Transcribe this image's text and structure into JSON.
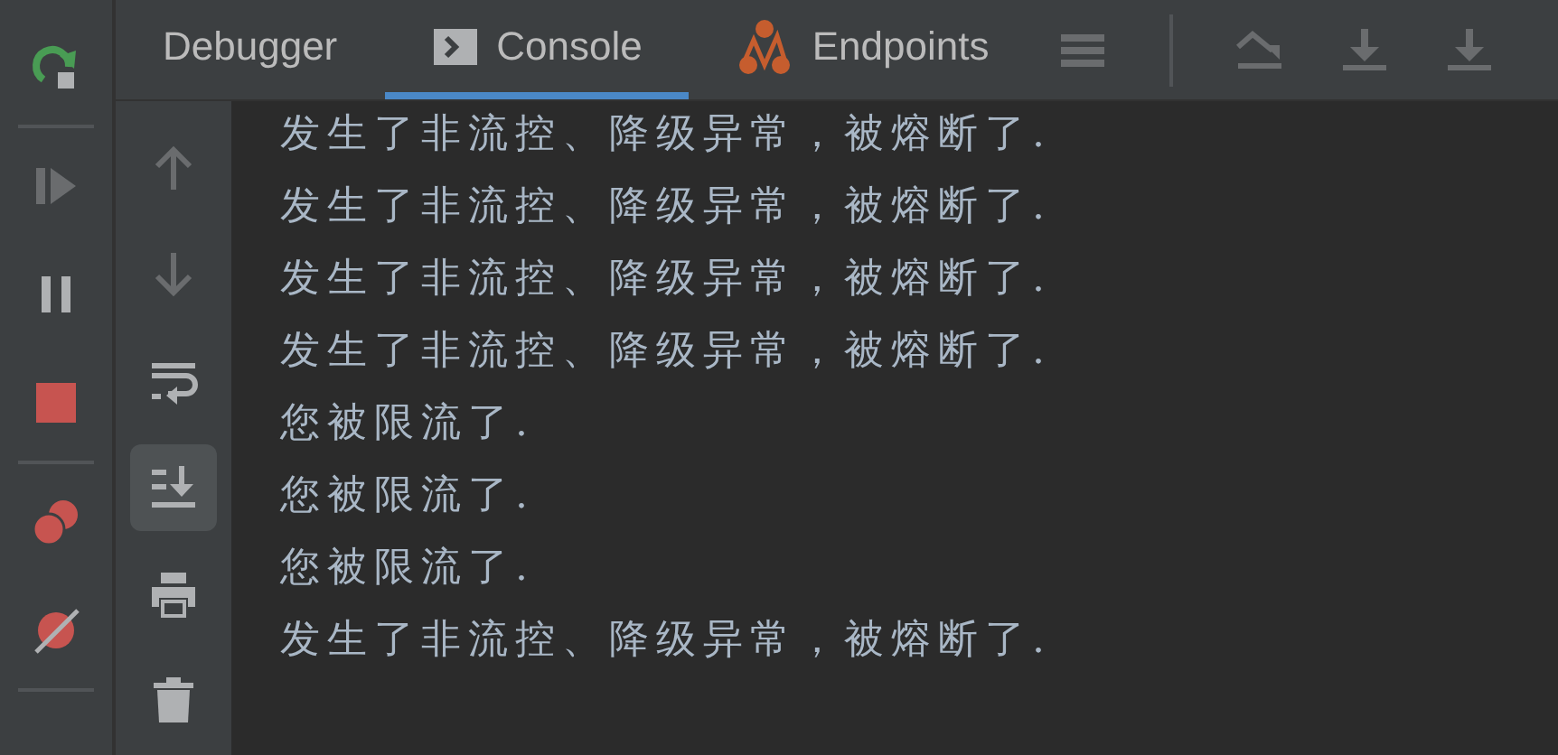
{
  "debug_toolbar": [
    {
      "kind": "rerun",
      "disabled": false
    },
    {
      "kind": "separator"
    },
    {
      "kind": "resume",
      "disabled": true
    },
    {
      "kind": "pause",
      "disabled": false
    },
    {
      "kind": "stop",
      "disabled": false
    },
    {
      "kind": "separator"
    },
    {
      "kind": "breakpoints",
      "disabled": false
    },
    {
      "kind": "mute",
      "disabled": false
    },
    {
      "kind": "separator"
    }
  ],
  "tabs": [
    {
      "label": "Debugger",
      "kind": "plain",
      "selected": false
    },
    {
      "label": "Console",
      "kind": "console",
      "selected": true
    },
    {
      "label": "Endpoints",
      "kind": "endpoints",
      "selected": false
    }
  ],
  "tab_toolbar": [
    {
      "kind": "menu",
      "disabled": true
    },
    {
      "kind": "separator"
    },
    {
      "kind": "step-over",
      "disabled": true
    },
    {
      "kind": "step-into",
      "disabled": true
    },
    {
      "kind": "step-force",
      "disabled": true
    }
  ],
  "console_toolbar": [
    {
      "kind": "up",
      "disabled": true,
      "selected": false
    },
    {
      "kind": "down",
      "disabled": true,
      "selected": false
    },
    {
      "kind": "wrap",
      "disabled": false,
      "selected": false
    },
    {
      "kind": "scroll-end",
      "disabled": false,
      "selected": true
    },
    {
      "kind": "print",
      "disabled": false,
      "selected": false
    },
    {
      "kind": "clear",
      "disabled": false,
      "selected": false
    }
  ],
  "console_lines": [
    "发生了非流控、降级异常，被熔断了.",
    "发生了非流控、降级异常，被熔断了.",
    "发生了非流控、降级异常，被熔断了.",
    "发生了非流控、降级异常，被熔断了.",
    "您被限流了.",
    "您被限流了.",
    "您被限流了.",
    "发生了非流控、降级异常，被熔断了."
  ]
}
